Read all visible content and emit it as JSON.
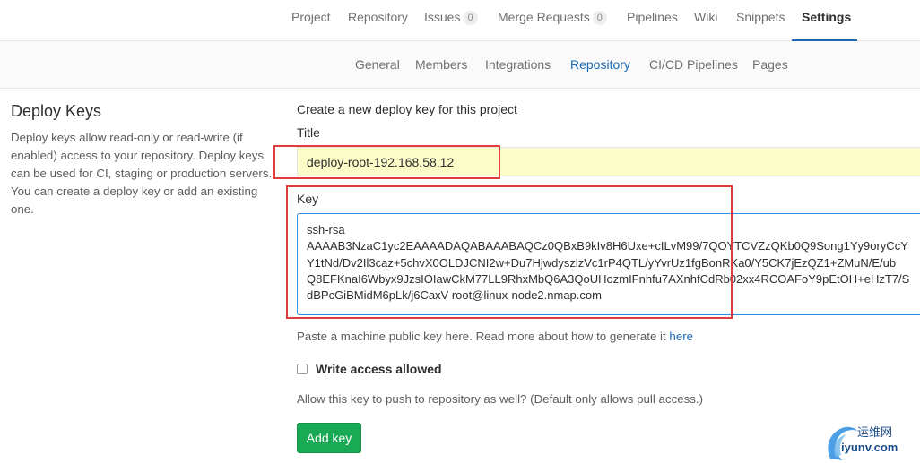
{
  "top_nav": {
    "tabs": [
      {
        "label": "Project"
      },
      {
        "label": "Repository"
      },
      {
        "label": "Issues",
        "count": "0"
      },
      {
        "label": "Merge Requests",
        "count": "0"
      },
      {
        "label": "Pipelines"
      },
      {
        "label": "Wiki"
      },
      {
        "label": "Snippets"
      },
      {
        "label": "Settings",
        "active": true
      }
    ]
  },
  "sub_nav": {
    "tabs": [
      {
        "label": "General"
      },
      {
        "label": "Members"
      },
      {
        "label": "Integrations"
      },
      {
        "label": "Repository",
        "active": true
      },
      {
        "label": "CI/CD Pipelines"
      },
      {
        "label": "Pages"
      }
    ]
  },
  "section": {
    "title": "Deploy Keys",
    "description": "Deploy keys allow read-only or read-write (if enabled) access to your repository. Deploy keys can be used for CI, staging or production servers. You can create a deploy key or add an existing one."
  },
  "form": {
    "heading": "Create a new deploy key for this project",
    "title_label": "Title",
    "title_value": "deploy-root-192.168.58.12",
    "key_label": "Key",
    "key_lines": [
      "ssh-rsa",
      "AAAAB3NzaC1yc2EAAAADAQABAAABAQCz0QBxB9kIv8H6Uxe+cILvM99/7QOYTCVZzQKb0Q9Song1Yy9oryCcY",
      "Y1tNd/Dv2Il3caz+5chvX0OLDJCNI2w+Du7HjwdyszlzVc1rP4QTL/yYvrUz1fgBonRKa0/Y5CK7jEzQZ1+ZMuN/E/ub",
      "Q8EFKnaI6Wbyx9JzsIOIawCkM77LL9RhxMbQ6A3QoUHozmIFnhfu7AXnhfCdRb02xx4RCOAFoY9pEtOH+eHzT7/S",
      "dBPcGiBMidM6pLk/j6CaxV root@linux-node2.nmap.com"
    ],
    "help_text": "Paste a machine public key here. Read more about how to generate it",
    "help_link": "here",
    "write_access_label": "Write access allowed",
    "allow_text": "Allow this key to push to repository as well? (Default only allows pull access.)",
    "submit_label": "Add key"
  },
  "watermark": {
    "cn_text": "运维网",
    "url_text": "iyunv.com"
  },
  "colors": {
    "accent": "#1b69b6",
    "button_green": "#1aaa55",
    "highlight_red": "#e03c3c",
    "autofill_yellow": "#fbfcc8"
  }
}
